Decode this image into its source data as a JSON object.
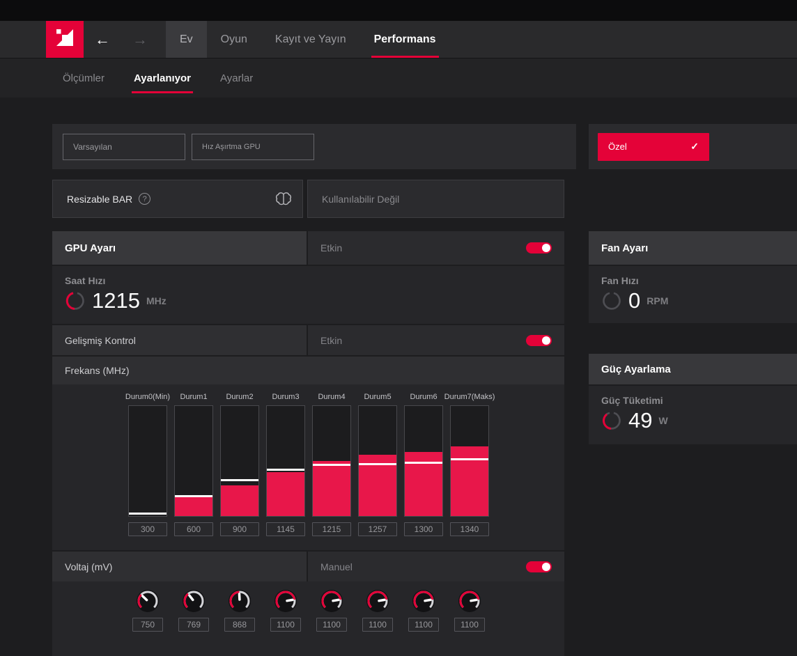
{
  "colors": {
    "accent": "#e40238",
    "bar_fill": "#e8174a"
  },
  "nav": {
    "back_icon": "←",
    "forward_icon": "→",
    "items": [
      {
        "label": "Ev"
      },
      {
        "label": "Oyun"
      },
      {
        "label": "Kayıt ve Yayın"
      },
      {
        "label": "Performans"
      }
    ]
  },
  "subnav": {
    "items": [
      {
        "label": "Ölçümler"
      },
      {
        "label": "Ayarlanıyor"
      },
      {
        "label": "Ayarlar"
      }
    ]
  },
  "presets": {
    "default_label": "Varsayılan",
    "oc_label": "Hız Aşırtma GPU",
    "custom_label": "Özel",
    "custom_check": "✓"
  },
  "rebar": {
    "label": "Resizable BAR",
    "help_icon": "?",
    "status": "Kullanılabilir Değil"
  },
  "gpu_tuning": {
    "header": "GPU Ayarı",
    "status": "Etkin",
    "clock": {
      "label": "Saat Hızı",
      "value": "1215",
      "unit": "MHz",
      "gauge": 0.64
    },
    "advanced": {
      "label": "Gelişmiş Kontrol",
      "status": "Etkin"
    },
    "frequency": {
      "label": "Frekans (MHz)",
      "chart": {
        "type": "bar",
        "states": [
          {
            "label": "Durum0(Min)",
            "value": "300",
            "fill": 0.0,
            "marker": 0.02
          },
          {
            "label": "Durum1",
            "value": "600",
            "fill": 0.185,
            "marker": 0.18
          },
          {
            "label": "Durum2",
            "value": "900",
            "fill": 0.28,
            "marker": 0.32
          },
          {
            "label": "Durum3",
            "value": "1145",
            "fill": 0.4,
            "marker": 0.42
          },
          {
            "label": "Durum4",
            "value": "1215",
            "fill": 0.5,
            "marker": 0.46
          },
          {
            "label": "Durum5",
            "value": "1257",
            "fill": 0.555,
            "marker": 0.47
          },
          {
            "label": "Durum6",
            "value": "1300",
            "fill": 0.585,
            "marker": 0.48
          },
          {
            "label": "Durum7(Maks)",
            "value": "1340",
            "fill": 0.63,
            "marker": 0.51
          }
        ]
      }
    },
    "voltage": {
      "label": "Voltaj (mV)",
      "mode": "Manuel",
      "knobs": [
        {
          "value": "750",
          "frac": 0.33
        },
        {
          "value": "769",
          "frac": 0.36
        },
        {
          "value": "868",
          "frac": 0.49
        },
        {
          "value": "1100",
          "frac": 0.8
        },
        {
          "value": "1100",
          "frac": 0.8
        },
        {
          "value": "1100",
          "frac": 0.8
        },
        {
          "value": "1100",
          "frac": 0.8
        },
        {
          "value": "1100",
          "frac": 0.8
        }
      ]
    }
  },
  "fan": {
    "header": "Fan Ayarı",
    "metric": {
      "label": "Fan Hızı",
      "value": "0",
      "unit": "RPM",
      "gauge": 0
    }
  },
  "power": {
    "header": "Güç Ayarlama",
    "metric": {
      "label": "Güç Tüketimi",
      "value": "49",
      "unit": "W",
      "gauge": 0.55
    }
  }
}
